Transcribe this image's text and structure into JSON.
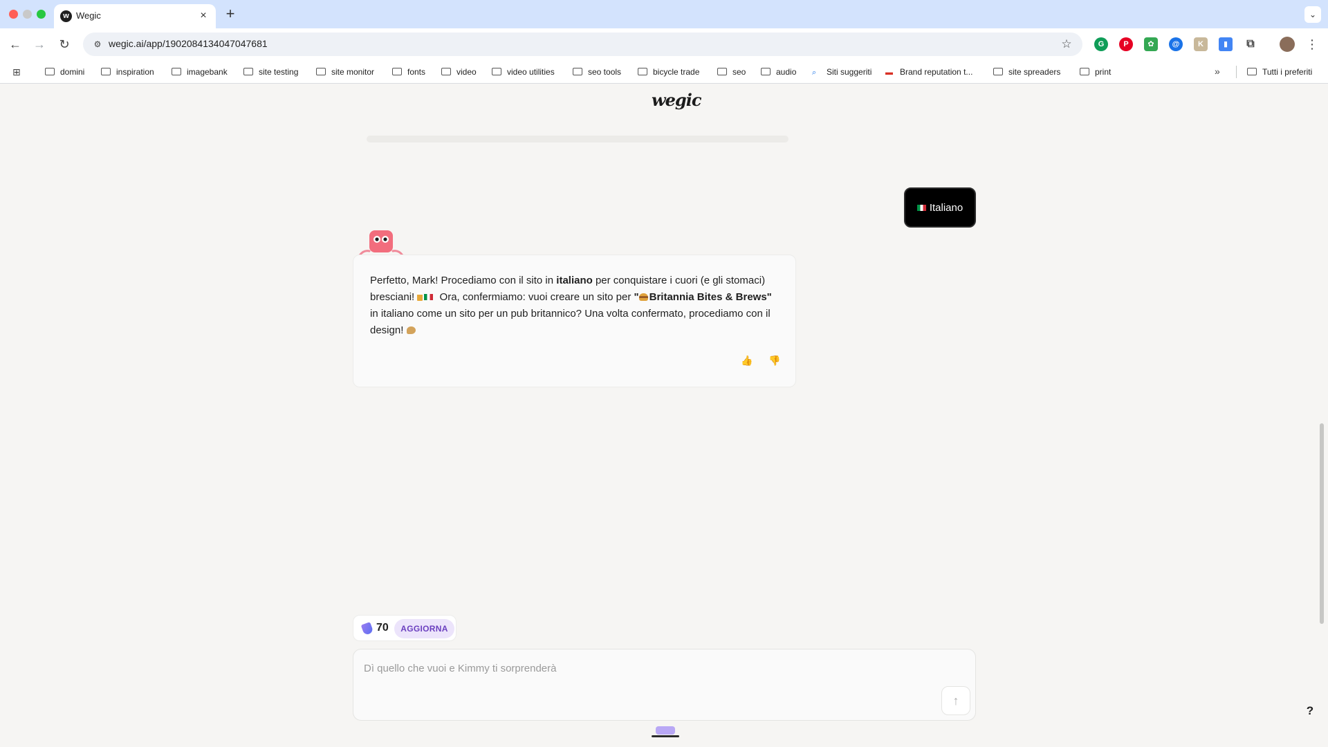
{
  "browser": {
    "tab_title": "Wegic",
    "tab_favicon": "w",
    "url": "wegic.ai/app/1902084134047047681",
    "bookmarks": [
      {
        "label": "domini",
        "icon": "folder-icon"
      },
      {
        "label": "inspiration",
        "icon": "folder-icon"
      },
      {
        "label": "imagebank",
        "icon": "folder-icon"
      },
      {
        "label": "site testing",
        "icon": "folder-icon"
      },
      {
        "label": "site monitor",
        "icon": "folder-icon"
      },
      {
        "label": "fonts",
        "icon": "folder-icon"
      },
      {
        "label": "video",
        "icon": "folder-icon"
      },
      {
        "label": "video utilities",
        "icon": "folder-icon"
      },
      {
        "label": "seo tools",
        "icon": "folder-icon"
      },
      {
        "label": "bicycle trade",
        "icon": "folder-icon"
      },
      {
        "label": "seo",
        "icon": "folder-icon"
      },
      {
        "label": "audio",
        "icon": "folder-icon"
      },
      {
        "label": "Siti suggeriti",
        "icon": "search-icon"
      },
      {
        "label": "Brand reputation t...",
        "icon": "brand-icon"
      },
      {
        "label": "site spreaders",
        "icon": "folder-icon"
      },
      {
        "label": "print",
        "icon": "folder-icon"
      }
    ],
    "all_bookmarks": "Tutti i preferiti"
  },
  "page": {
    "logo": "wegic",
    "user_message": "Italiano",
    "assistant": {
      "part1": "Perfetto, Mark! Procediamo con il sito in ",
      "bold1": "italiano",
      "part2": " per conquistare i cuori (e gli stomaci) bresciani! ",
      "part3": " Ora, confermiamo: vuoi creare un sito per ",
      "quote_open": "\"",
      "bold2": "Britannia Bites & Brews",
      "quote_close": "\"",
      "part4": " in italiano come un sito per un pub britannico? Una volta confermato, procediamo con il design! "
    },
    "credits": "70",
    "upgrade_label": "AGGIORNA",
    "composer_placeholder": "Dì quello che vuoi e Kimmy ti sorprenderà",
    "help": "?"
  },
  "colors": {
    "accent_purple": "#6b3fbf",
    "upgrade_bg": "#ece4fb",
    "page_bg": "#f6f5f3",
    "user_bubble": "#000000"
  }
}
